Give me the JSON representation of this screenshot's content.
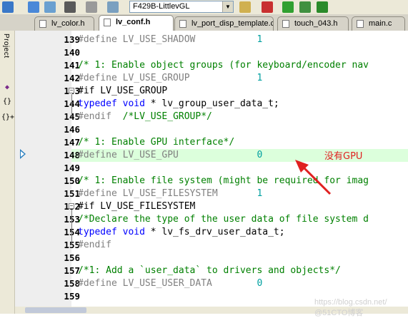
{
  "toolbar": {
    "target": "F429B-LittlevGL",
    "icons": [
      "build-icon",
      "rebuild-icon",
      "batch-build-icon",
      "translate-icon",
      "stop-build-icon",
      "download-icon",
      "target-options-icon",
      "manage-components-icon",
      "pack-installer-icon",
      "debug-icon"
    ]
  },
  "tabs": [
    {
      "label": "lv_color.h",
      "active": false,
      "color": "#dcdcf0"
    },
    {
      "label": "lv_conf.h",
      "active": true,
      "color": "#ffffff"
    },
    {
      "label": "lv_port_disp_template.c",
      "active": false,
      "color": "#d9d2f5"
    },
    {
      "label": "touch_043.h",
      "active": false,
      "color": "#f3d6dc"
    },
    {
      "label": "main.c",
      "active": false,
      "color": "#dcdcf0"
    }
  ],
  "sidebar": {
    "label": "Project",
    "icons": [
      "books-icon",
      "functions-icon",
      "templates-icon"
    ],
    "glyphs": [
      "{}",
      "{}+"
    ]
  },
  "lines": [
    {
      "n": "139",
      "parts": [
        [
          "pp",
          "#define LV_USE_SHADOW           "
        ],
        [
          "num",
          "1"
        ]
      ]
    },
    {
      "n": "140",
      "parts": []
    },
    {
      "n": "141",
      "parts": [
        [
          "cm",
          "/* 1: Enable object groups (for keyboard/encoder nav"
        ]
      ]
    },
    {
      "n": "142",
      "parts": [
        [
          "pp",
          "#define LV_USE_GROUP            "
        ],
        [
          "num",
          "1"
        ]
      ]
    },
    {
      "n": "143",
      "fold": "minus",
      "parts": [
        [
          "tx",
          "#if LV_USE_GROUP"
        ]
      ]
    },
    {
      "n": "144",
      "parts": [
        [
          "kw",
          "typedef void"
        ],
        [
          "tx",
          " * lv_group_user_data_t;"
        ]
      ]
    },
    {
      "n": "145",
      "parts": [
        [
          "pp",
          "#endif  "
        ],
        [
          "cm",
          "/*LV_USE_GROUP*/"
        ]
      ]
    },
    {
      "n": "146",
      "parts": []
    },
    {
      "n": "147",
      "parts": [
        [
          "cm",
          "/* 1: Enable GPU interface*/"
        ]
      ]
    },
    {
      "n": "148",
      "highlight": true,
      "parts": [
        [
          "pp",
          "#define LV_USE_GPU              "
        ],
        [
          "num",
          "0"
        ]
      ]
    },
    {
      "n": "149",
      "parts": []
    },
    {
      "n": "150",
      "parts": [
        [
          "cm",
          "/* 1: Enable file system (might be required for imag"
        ]
      ]
    },
    {
      "n": "151",
      "parts": [
        [
          "pp",
          "#define LV_USE_FILESYSTEM       "
        ],
        [
          "num",
          "1"
        ]
      ]
    },
    {
      "n": "152",
      "fold": "minus",
      "parts": [
        [
          "tx",
          "#if LV_USE_FILESYSTEM"
        ]
      ]
    },
    {
      "n": "153",
      "parts": [
        [
          "cm",
          "/*Declare the type of the user data of file system d"
        ]
      ]
    },
    {
      "n": "154",
      "parts": [
        [
          "kw",
          "typedef void"
        ],
        [
          "tx",
          " * lv_fs_drv_user_data_t;"
        ]
      ]
    },
    {
      "n": "155",
      "parts": [
        [
          "pp",
          "#endif"
        ]
      ]
    },
    {
      "n": "156",
      "parts": []
    },
    {
      "n": "157",
      "parts": [
        [
          "cm",
          "/*1: Add a `user_data` to drivers and objects*/"
        ]
      ]
    },
    {
      "n": "158",
      "parts": [
        [
          "pp",
          "#define LV_USE_USER_DATA        "
        ],
        [
          "num",
          "0"
        ]
      ]
    },
    {
      "n": "159",
      "parts": []
    }
  ],
  "annotation": "没有GPU",
  "watermark": "https://blog.csdn.net/ @51CTO博客",
  "colors": {
    "preprocessor": "#808080",
    "comment": "#008000",
    "number": "#00a0a0",
    "keyword": "#0000ff",
    "annotation": "#e02020",
    "highlight_line": "#dcffdc"
  }
}
